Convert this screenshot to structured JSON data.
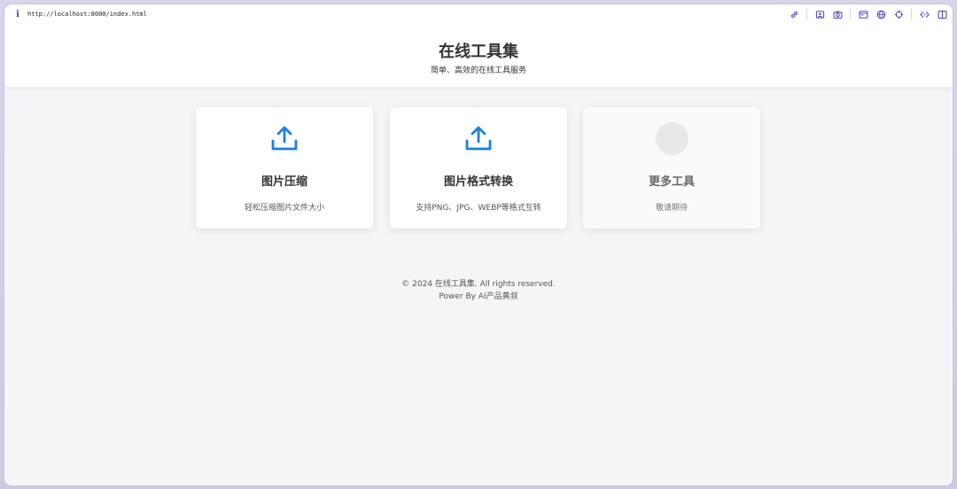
{
  "browser": {
    "url": "http://localhost:8000/index.html",
    "accent_color": "#4a3bb8"
  },
  "header": {
    "title": "在线工具集",
    "subtitle": "简单、高效的在线工具服务"
  },
  "cards": [
    {
      "title": "图片压缩",
      "description": "轻松压缩图片文件大小",
      "icon": "upload-icon"
    },
    {
      "title": "图片格式转换",
      "description": "支持PNG、JPG、WEBP等格式互转",
      "icon": "upload-icon"
    },
    {
      "title": "更多工具",
      "description": "敬请期待",
      "icon": "placeholder-circle"
    }
  ],
  "footer": {
    "copyright": "© 2024 在线工具集. All rights reserved.",
    "power": "Power By AI产品黄叔"
  },
  "colors": {
    "upload_icon": "#1a7fe0",
    "background": "#f5f5f7"
  }
}
